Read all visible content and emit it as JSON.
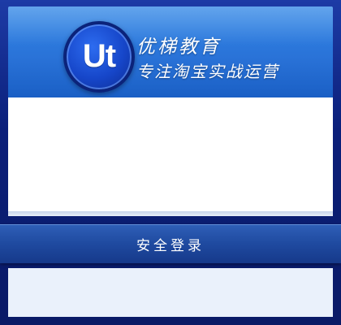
{
  "header": {
    "logo_text": "Ut",
    "brand_title": "优梯教育",
    "brand_subtitle": "专注淘宝实战运营"
  },
  "login": {
    "button_label": "安全登录"
  },
  "colors": {
    "header_blue": "#2a73d8",
    "frame_navy": "#0b1f7a",
    "band_blue": "#1f4aa0",
    "panel_white": "#ffffff"
  }
}
